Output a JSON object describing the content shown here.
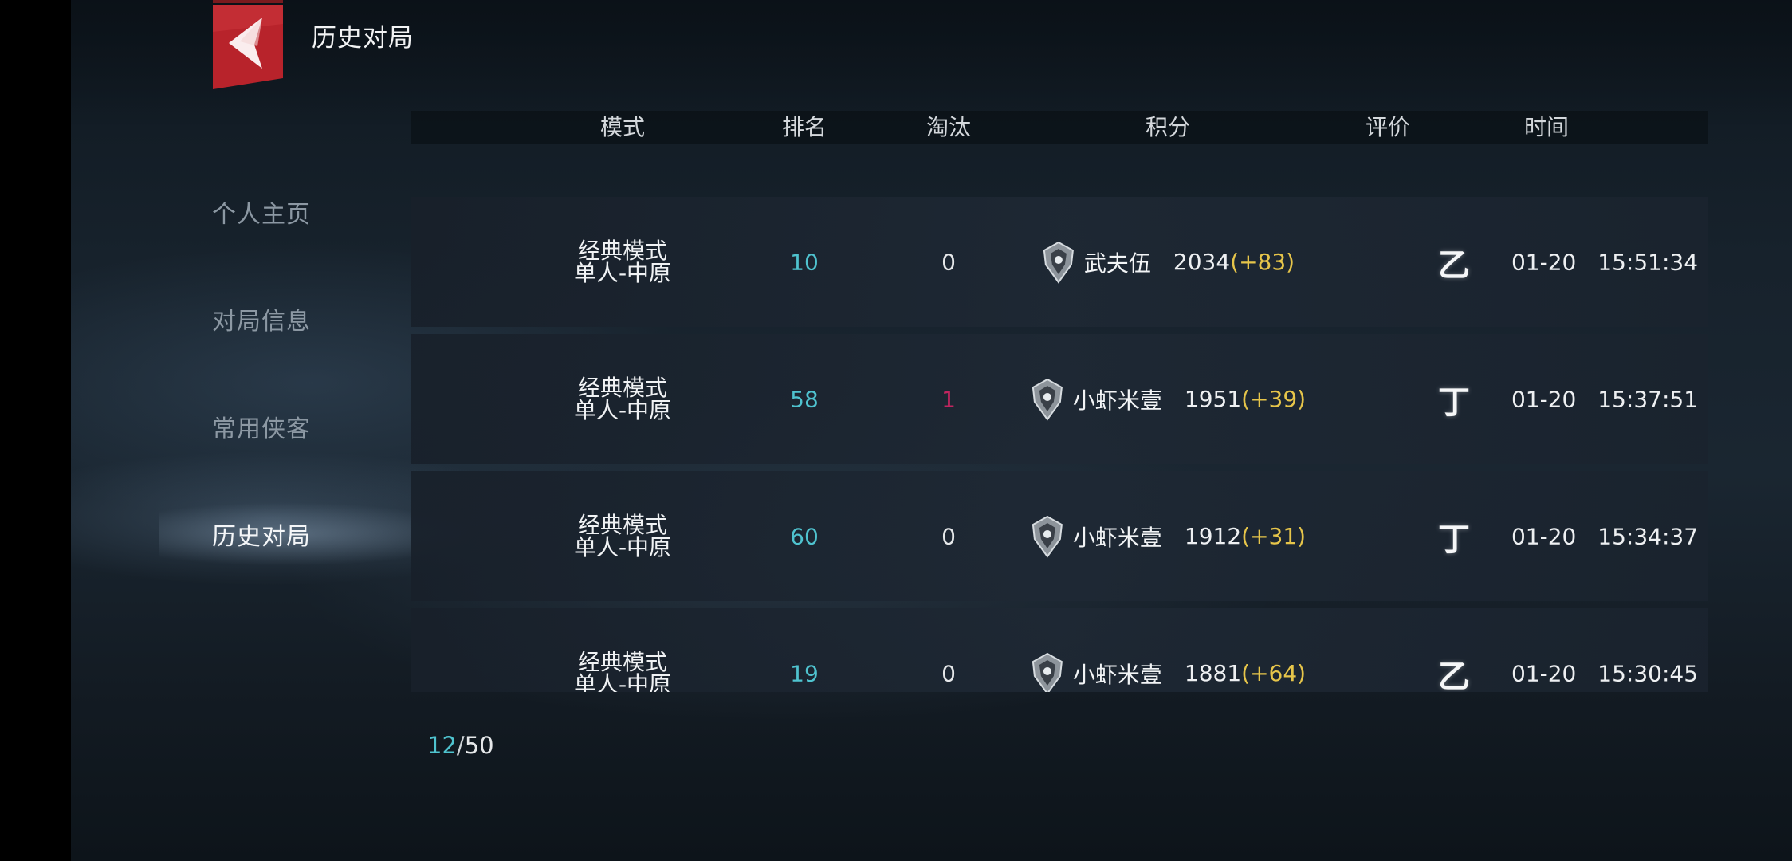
{
  "header": {
    "title": "历史对局"
  },
  "sidebar": {
    "items": [
      {
        "label": "个人主页"
      },
      {
        "label": "对局信息"
      },
      {
        "label": "常用侠客"
      },
      {
        "label": "历史对局"
      }
    ],
    "active_index": 3
  },
  "table": {
    "columns": [
      "模式",
      "排名",
      "淘汰",
      "积分",
      "评价",
      "时间"
    ],
    "rows": [
      {
        "mode_line1": "经典模式",
        "mode_line2": "单人-中原",
        "rank": "10",
        "eliminations": "0",
        "player": "武夫伍",
        "score": "2034",
        "delta": "(+83)",
        "grade": "乙",
        "date": "01-20",
        "time": "15:51:34"
      },
      {
        "mode_line1": "经典模式",
        "mode_line2": "单人-中原",
        "rank": "58",
        "eliminations": "1",
        "player": "小虾米壹",
        "score": "1951",
        "delta": "(+39)",
        "grade": "丁",
        "date": "01-20",
        "time": "15:37:51"
      },
      {
        "mode_line1": "经典模式",
        "mode_line2": "单人-中原",
        "rank": "60",
        "eliminations": "0",
        "player": "小虾米壹",
        "score": "1912",
        "delta": "(+31)",
        "grade": "丁",
        "date": "01-20",
        "time": "15:34:37"
      },
      {
        "mode_line1": "经典模式",
        "mode_line2": "单人-中原",
        "rank": "19",
        "eliminations": "0",
        "player": "小虾米壹",
        "score": "1881",
        "delta": "(+64)",
        "grade": "乙",
        "date": "01-20",
        "time": "15:30:45"
      }
    ]
  },
  "pagination": {
    "current": "12",
    "separator": "/",
    "total": "50"
  },
  "colors": {
    "accent_cyan": "#4fc3cf",
    "score_delta": "#e6c54a",
    "elimination_red": "#c2255f",
    "badge_red": "#b8232b"
  },
  "icons": {
    "back": "back-chevron-icon",
    "rank": "rank-emblem-icon",
    "row_arrow": "play-arrow-icon"
  }
}
